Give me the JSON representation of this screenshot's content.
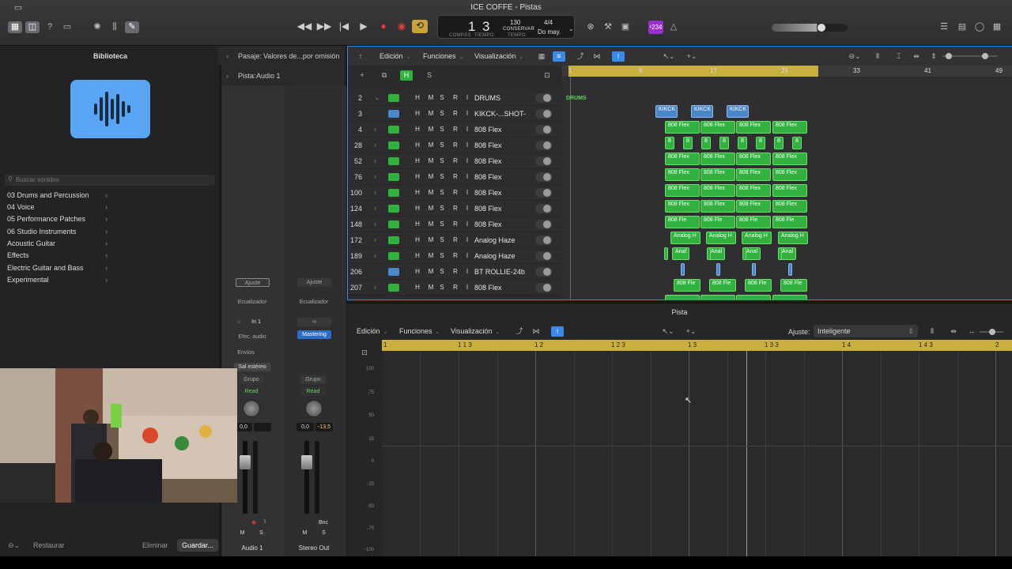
{
  "window": {
    "title": "ICE COFFE  - Pistas"
  },
  "transport": {
    "compas": "1",
    "tiempo": "3",
    "compas_label": "COMPÁS",
    "tiempo_label": "TIEMPO",
    "tempo": "130",
    "tempo_mode": "CONSERVAR",
    "tempo_label": "TEMPO",
    "signature": "4/4",
    "key": "Do may.",
    "count_badge": "¹234"
  },
  "library": {
    "title": "Biblioteca",
    "search_placeholder": "Buscar sonidos",
    "items": [
      "03 Drums and Percussion",
      "04 Voice",
      "05 Performance Patches",
      "06 Studio Instruments",
      "Acoustic Guitar",
      "Effects",
      "Electric Guitar and Bass",
      "Experimental"
    ],
    "footer": {
      "restore": "Restaurar",
      "delete": "Eliminar",
      "save": "Guardar..."
    }
  },
  "inspector": {
    "region_label": "Pasaje:",
    "region_value": "Valores de...por omisión",
    "track_label": "Pista:",
    "track_value": "Audio 1",
    "strip1": {
      "ajuste": "Ajuste",
      "eq": "Ecualizador",
      "input": "In 1",
      "fx": "Efec. audio",
      "sends": "Envíos",
      "output": "Sal estéreo",
      "group": "Grupo",
      "auto": "Read",
      "vol": "0,0",
      "m": "M",
      "s": "S",
      "name": "Audio 1"
    },
    "strip2": {
      "ajuste": "Ajuste",
      "eq": "Ecualizador",
      "plugin": "Mastering",
      "group": "Grupo",
      "auto": "Read",
      "vol": "0,0",
      "peak": "-13,5",
      "bnc": "Bnc",
      "m": "M",
      "s": "S",
      "name": "Stereo Out"
    }
  },
  "tracks_toolbar": {
    "menus": [
      "Edición",
      "Funciones",
      "Visualización"
    ],
    "h": "H",
    "s": "S"
  },
  "tracks": [
    {
      "num": "2",
      "name": "DRUMS",
      "folder": true
    },
    {
      "num": "3",
      "name": "KIKCK-...SHOT-",
      "blue": true
    },
    {
      "num": "4",
      "name": "808 Flex"
    },
    {
      "num": "28",
      "name": "808 Flex"
    },
    {
      "num": "52",
      "name": "808 Flex"
    },
    {
      "num": "76",
      "name": "808 Flex"
    },
    {
      "num": "100",
      "name": "808 Flex"
    },
    {
      "num": "124",
      "name": "808 Flex"
    },
    {
      "num": "148",
      "name": "808 Flex"
    },
    {
      "num": "172",
      "name": "Analog Haze"
    },
    {
      "num": "189",
      "name": "Analog Haze"
    },
    {
      "num": "206",
      "name": "BT ROLLIE-24b",
      "blue": true
    },
    {
      "num": "207",
      "name": "808 Flex"
    }
  ],
  "track_buttons": [
    "H",
    "M",
    "S",
    "R",
    "I"
  ],
  "ruler": [
    "1",
    "9",
    "17",
    "25",
    "33",
    "41",
    "49"
  ],
  "region_labels": {
    "drums": "DRUMS",
    "kick": "KIKCK",
    "flex": "808 Flex",
    "flex_short": "808 Fle",
    "flex_tiny": "8",
    "haze": "Analog H",
    "anal": "Anal"
  },
  "editor": {
    "title": "Pista",
    "menus": [
      "Edición",
      "Funciones",
      "Visualización"
    ],
    "snap_label": "Ajuste:",
    "snap_value": "Inteligente",
    "ruler": [
      "1",
      "1 1 3",
      "1 2",
      "1 2 3",
      "1 3",
      "1 3 3",
      "1 4",
      "1 4 3",
      "2"
    ],
    "scale": [
      "100",
      "75",
      "50",
      "25",
      "0",
      "-25",
      "-50",
      "-75",
      "-100"
    ]
  }
}
